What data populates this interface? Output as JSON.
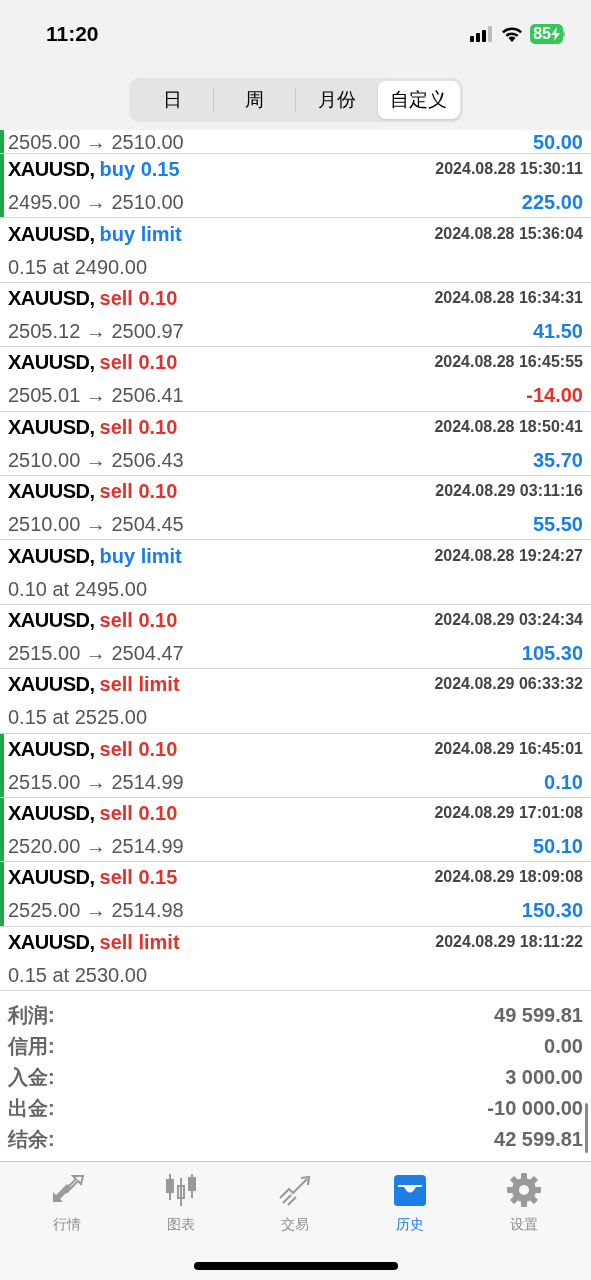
{
  "status_bar": {
    "time": "11:20",
    "battery": "85"
  },
  "segments": [
    {
      "label": "日",
      "selected": false
    },
    {
      "label": "周",
      "selected": false
    },
    {
      "label": "月份",
      "selected": false
    },
    {
      "label": "自定义",
      "selected": true
    }
  ],
  "partial_row": {
    "line2": "2505.00 → 2510.00",
    "profit": "50.00",
    "loss": false,
    "marked": true
  },
  "rows": [
    {
      "symbol": "XAUUSD,",
      "kind": "buy",
      "order": "buy 0.15",
      "time": "2024.08.28 15:30:11",
      "line2": "2495.00 → 2510.00",
      "profit": "225.00",
      "loss": false,
      "marked": true
    },
    {
      "symbol": "XAUUSD,",
      "kind": "buy",
      "order": "buy limit",
      "time": "2024.08.28 15:36:04",
      "line2": "0.15 at 2490.00",
      "marked": false
    },
    {
      "symbol": "XAUUSD,",
      "kind": "sell",
      "order": "sell 0.10",
      "time": "2024.08.28 16:34:31",
      "line2": "2505.12 → 2500.97",
      "profit": "41.50",
      "loss": false,
      "marked": false
    },
    {
      "symbol": "XAUUSD,",
      "kind": "sell",
      "order": "sell 0.10",
      "time": "2024.08.28 16:45:55",
      "line2": "2505.01 → 2506.41",
      "profit": "-14.00",
      "loss": true,
      "marked": false
    },
    {
      "symbol": "XAUUSD,",
      "kind": "sell",
      "order": "sell 0.10",
      "time": "2024.08.28 18:50:41",
      "line2": "2510.00 → 2506.43",
      "profit": "35.70",
      "loss": false,
      "marked": false
    },
    {
      "symbol": "XAUUSD,",
      "kind": "sell",
      "order": "sell 0.10",
      "time": "2024.08.29 03:11:16",
      "line2": "2510.00 → 2504.45",
      "profit": "55.50",
      "loss": false,
      "marked": false
    },
    {
      "symbol": "XAUUSD,",
      "kind": "buy",
      "order": "buy limit",
      "time": "2024.08.28 19:24:27",
      "line2": "0.10 at 2495.00",
      "marked": false
    },
    {
      "symbol": "XAUUSD,",
      "kind": "sell",
      "order": "sell 0.10",
      "time": "2024.08.29 03:24:34",
      "line2": "2515.00 → 2504.47",
      "profit": "105.30",
      "loss": false,
      "marked": false
    },
    {
      "symbol": "XAUUSD,",
      "kind": "sell",
      "order": "sell limit",
      "time": "2024.08.29 06:33:32",
      "line2": "0.15 at 2525.00",
      "marked": false
    },
    {
      "symbol": "XAUUSD,",
      "kind": "sell",
      "order": "sell 0.10",
      "time": "2024.08.29 16:45:01",
      "line2": "2515.00 → 2514.99",
      "profit": "0.10",
      "loss": false,
      "marked": true
    },
    {
      "symbol": "XAUUSD,",
      "kind": "sell",
      "order": "sell 0.10",
      "time": "2024.08.29 17:01:08",
      "line2": "2520.00 → 2514.99",
      "profit": "50.10",
      "loss": false,
      "marked": true
    },
    {
      "symbol": "XAUUSD,",
      "kind": "sell",
      "order": "sell 0.15",
      "time": "2024.08.29 18:09:08",
      "line2": "2525.00 → 2514.98",
      "profit": "150.30",
      "loss": false,
      "marked": true
    },
    {
      "symbol": "XAUUSD,",
      "kind": "sell",
      "order": "sell limit",
      "time": "2024.08.29 18:11:22",
      "line2": "0.15 at 2530.00",
      "marked": false
    }
  ],
  "summary": [
    {
      "label": "利润:",
      "value": "49 599.81"
    },
    {
      "label": "信用:",
      "value": "0.00"
    },
    {
      "label": "入金:",
      "value": "3 000.00"
    },
    {
      "label": "出金:",
      "value": "-10 000.00"
    },
    {
      "label": "结余:",
      "value": "42 599.81"
    }
  ],
  "tab_bar": [
    {
      "label": "行情",
      "selected": false
    },
    {
      "label": "图表",
      "selected": false
    },
    {
      "label": "交易",
      "selected": false
    },
    {
      "label": "历史",
      "selected": true
    },
    {
      "label": "设置",
      "selected": false
    }
  ]
}
